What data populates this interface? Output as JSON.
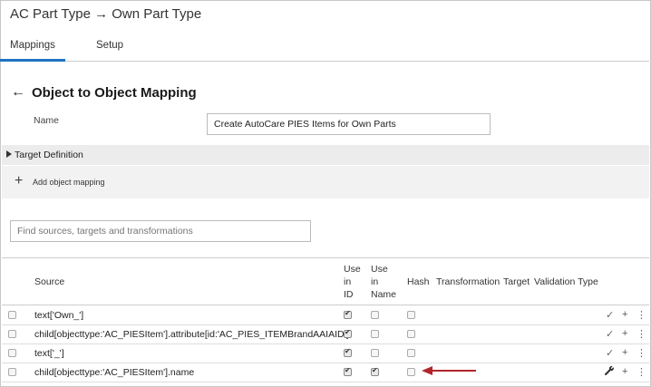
{
  "page": {
    "title": "AC Part Type → Own Part Type"
  },
  "tabs": [
    {
      "label": "Mappings"
    },
    {
      "label": "Setup"
    }
  ],
  "section": {
    "back_glyph": "←",
    "heading": "Object to Object Mapping"
  },
  "name_field": {
    "label": "Name",
    "value": "Create AutoCare PIES Items for Own Parts"
  },
  "target_definition": {
    "label": "Target Definition"
  },
  "add_mapping": {
    "icon": "+",
    "label": "Add object mapping"
  },
  "search": {
    "placeholder": "Find sources, targets and transformations"
  },
  "table": {
    "headers": {
      "source": "Source",
      "use_in_id_1": "Use",
      "use_in_id_2": "in",
      "use_in_id_3": "ID",
      "use_in_name_1": "Use",
      "use_in_name_2": "in",
      "use_in_name_3": "Name",
      "hash": "Hash",
      "transformation": "Transformation",
      "target": "Target",
      "validation_type": "Validation Type"
    },
    "rows": [
      {
        "source": "text['Own_']",
        "use_in_id": true,
        "use_in_name": false,
        "hash": false,
        "action": "check"
      },
      {
        "source": "child[objecttype:'AC_PIESItem'].attribute[id:'AC_PIES_ITEMBrandAAIAID']",
        "use_in_id": true,
        "use_in_name": false,
        "hash": false,
        "action": "check"
      },
      {
        "source": "text['_']",
        "use_in_id": true,
        "use_in_name": false,
        "hash": false,
        "action": "check"
      },
      {
        "source": "child[objecttype:'AC_PIESItem'].name",
        "use_in_id": true,
        "use_in_name": true,
        "hash": false,
        "action": "wrench"
      }
    ],
    "row_icons": {
      "check": "✓",
      "wrench": "🔧",
      "add": "+",
      "more": "⋮"
    }
  },
  "colors": {
    "accent": "#1e73be",
    "annotation_arrow": "#b0262a"
  }
}
